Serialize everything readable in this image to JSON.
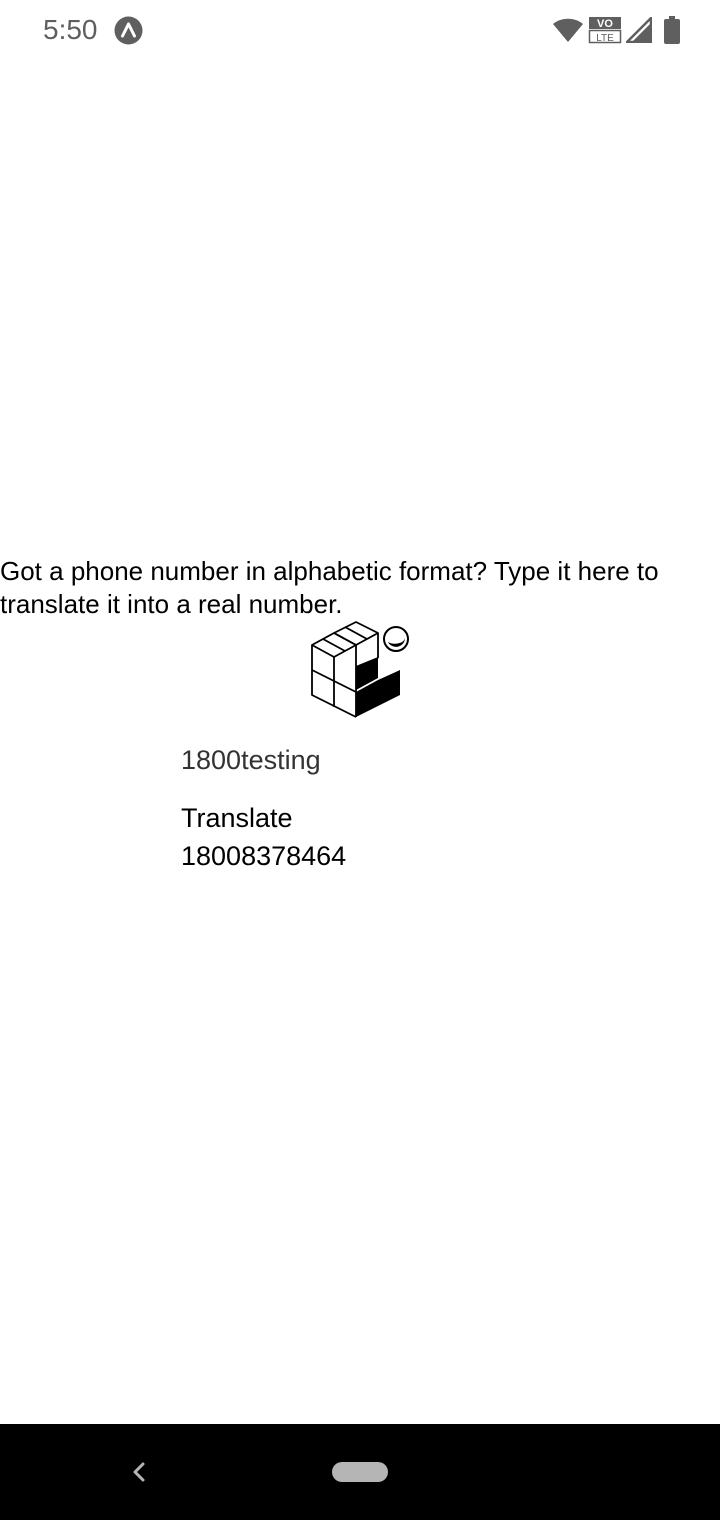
{
  "status_bar": {
    "time": "5:50",
    "app_icon": "arrow-up-circle-icon",
    "icons": [
      "wifi-icon",
      "volte-icon",
      "signal-icon",
      "battery-icon"
    ],
    "volte_top": "VO",
    "volte_bottom": "LTE"
  },
  "main": {
    "prompt": "Got a phone number in alphabetic format? Type it here to translate it into a real number.",
    "logo_icon": "cube-logo-icon",
    "input": {
      "value": "1800testing",
      "placeholder": ""
    },
    "translate_label": "Translate",
    "result": "18008378464"
  },
  "nav_bar": {
    "back_icon": "back-chevron-icon",
    "home_icon": "home-pill-icon"
  },
  "colors": {
    "status_text": "#5f5f5f",
    "nav_background": "#000000",
    "home_pill": "#b5b5b5"
  }
}
